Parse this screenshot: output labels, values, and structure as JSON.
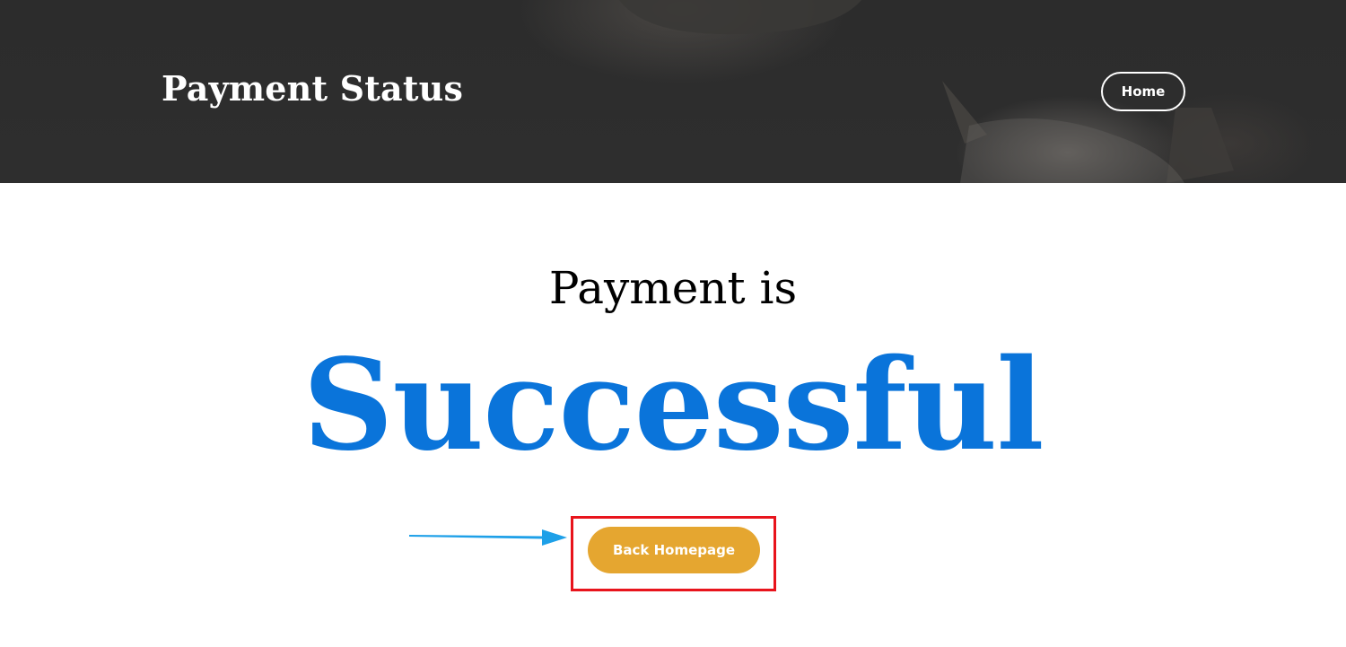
{
  "header": {
    "site_title": "Payment Status",
    "nav": {
      "home_label": "Home"
    }
  },
  "main": {
    "status_prefix": "Payment is",
    "status_word": "Successful",
    "back_button_label": "Back Homepage"
  },
  "colors": {
    "header_background": "#2e2e2e",
    "status_word": "#0a74da",
    "back_button": "#e5a630",
    "highlight_box": "#e8141c",
    "annotation_arrow": "#1ea0e8"
  },
  "icons": {
    "annotation": "arrow-right-icon"
  }
}
